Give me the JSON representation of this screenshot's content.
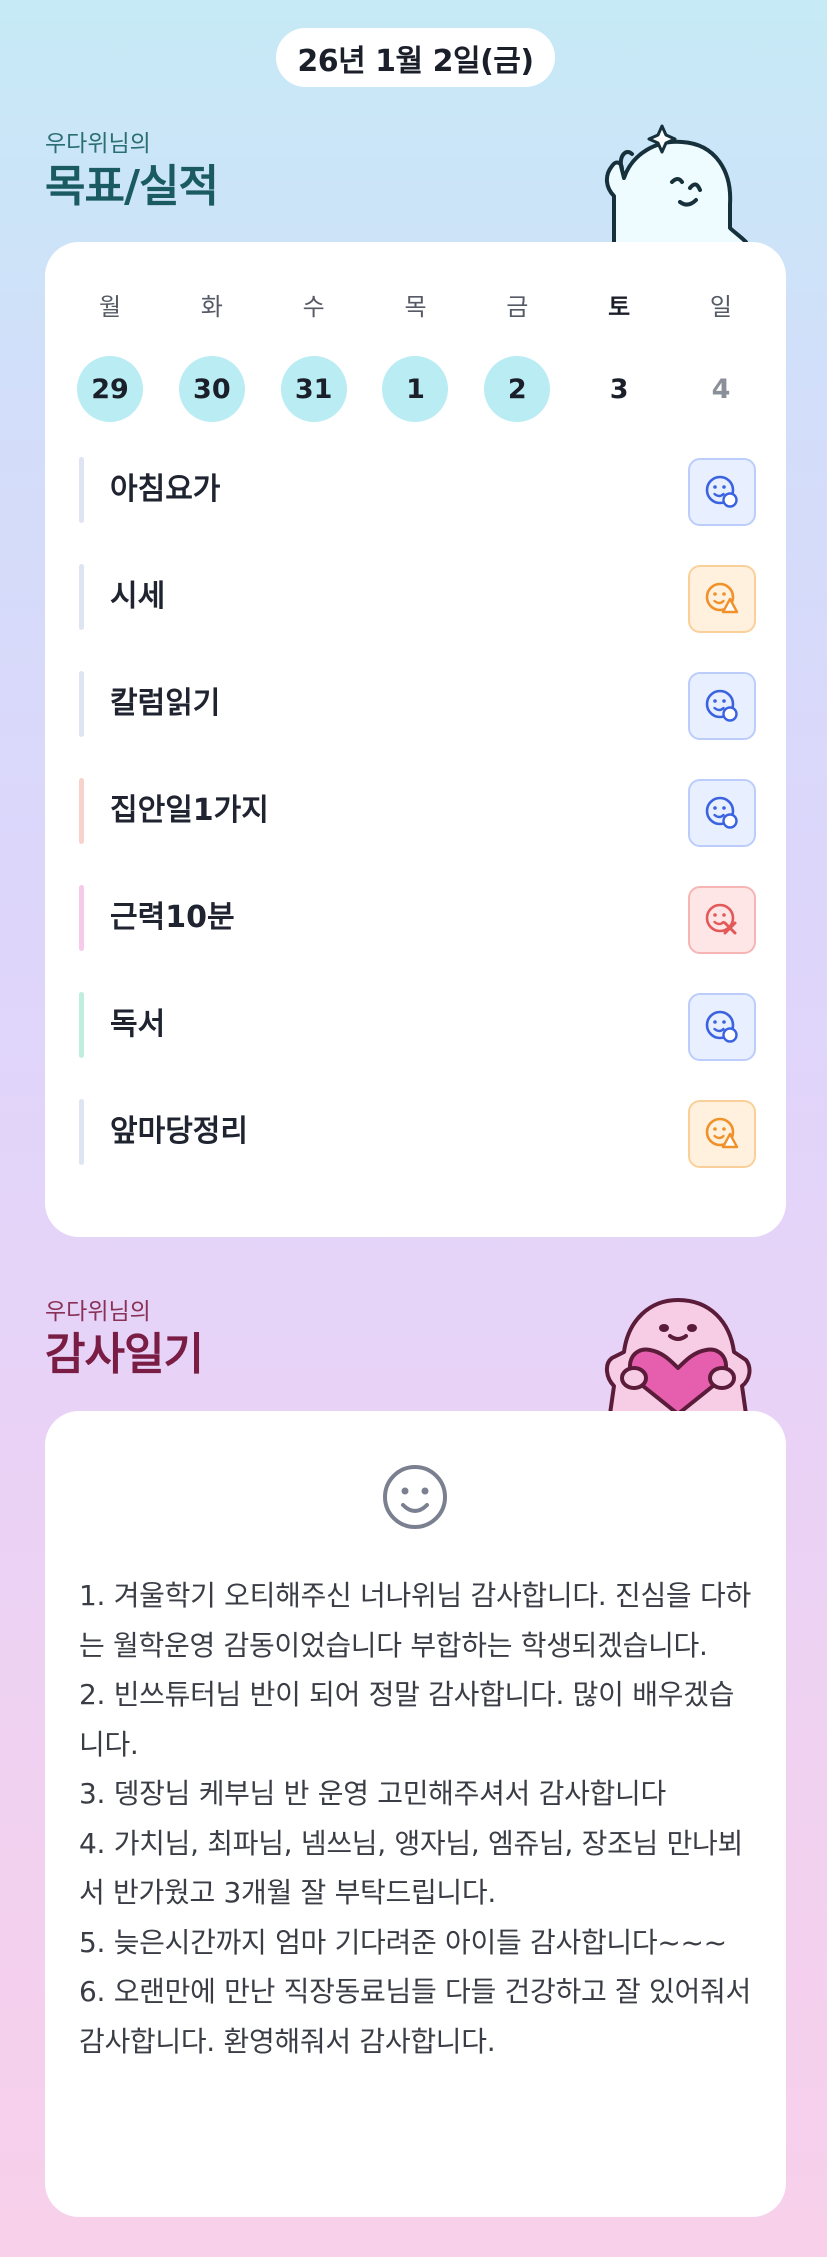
{
  "date": "26년 1월 2일(금)",
  "goals_section": {
    "subtitle": "우다위님의",
    "title": "목표/실적"
  },
  "week": {
    "days": [
      "월",
      "화",
      "수",
      "목",
      "금",
      "토",
      "일"
    ],
    "dates": [
      "29",
      "30",
      "31",
      "1",
      "2",
      "3",
      "4"
    ],
    "completed": [
      true,
      true,
      true,
      true,
      true,
      false,
      false
    ]
  },
  "goals": [
    {
      "name": "아침요가",
      "bar_color": "#dfe4f3",
      "status": "done",
      "status_icon": "smile-check-icon"
    },
    {
      "name": "시세",
      "bar_color": "#dfe4f3",
      "status": "partial",
      "status_icon": "smile-warning-icon"
    },
    {
      "name": "칼럼읽기",
      "bar_color": "#dfe4f3",
      "status": "done",
      "status_icon": "smile-check-icon"
    },
    {
      "name": "집안일1가지",
      "bar_color": "#f8d3cc",
      "status": "done",
      "status_icon": "smile-check-icon"
    },
    {
      "name": "근력10분",
      "bar_color": "#f6cbe9",
      "status": "failed",
      "status_icon": "smile-x-icon"
    },
    {
      "name": "독서",
      "bar_color": "#bfeede",
      "status": "done",
      "status_icon": "smile-check-icon"
    },
    {
      "name": "앞마당정리",
      "bar_color": "#dfe4f3",
      "status": "partial",
      "status_icon": "smile-warning-icon"
    }
  ],
  "status_colors": {
    "done": {
      "bg": "#e8efff",
      "border": "#bccdfb",
      "fg": "#3b63e0"
    },
    "partial": {
      "bg": "#fff1de",
      "border": "#fad09a",
      "fg": "#f0912a"
    },
    "failed": {
      "bg": "#ffe6e6",
      "border": "#f6b5b5",
      "fg": "#e35858"
    }
  },
  "diary_section": {
    "subtitle": "우다위님의",
    "title": "감사일기"
  },
  "diary": {
    "mood_icon": "smile-face-icon",
    "text": "1. 겨울학기 오티해주신 너나위님 감사합니다. 진심을 다하는 월학운영 감동이었습니다 부합하는 학생되겠습니다.\n2. 빈쓰튜터님 반이 되어 정말 감사합니다. 많이 배우겠습니다.\n3. 뎅장님 케부님 반 운영 고민해주셔서 감사합니다\n4. 가치님, 최파님, 넴쓰님, 앵자님, 엠쥬님, 장조님 만나뵈서 반가웠고 3개월 잘 부탁드립니다.\n5. 늦은시간까지 엄마 기다려준 아이들 감사합니다~~~\n6. 오랜만에 만난 직장동료님들 다들 건강하고 잘 있어줘서 감사합니다. 환영해줘서 감사합니다."
  }
}
